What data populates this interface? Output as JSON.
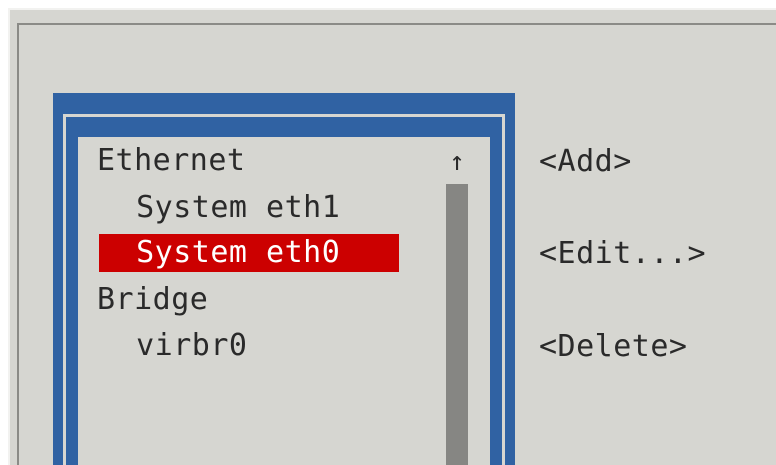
{
  "connection_list": {
    "items": [
      {
        "label": "Ethernet",
        "type": "category"
      },
      {
        "label": "System eth1",
        "type": "connection"
      },
      {
        "label": "System eth0",
        "type": "connection",
        "selected": true
      },
      {
        "label": "Bridge",
        "type": "category"
      },
      {
        "label": "virbr0",
        "type": "connection"
      }
    ],
    "scrollbar": {
      "up_arrow": "↑"
    }
  },
  "actions": {
    "add_label": "<Add>",
    "edit_label": "<Edit...>",
    "delete_label": "<Delete>"
  },
  "colors": {
    "background": "#d6d6d1",
    "frame": "#3062a3",
    "selection": "#cc0000",
    "text": "#2a2a2a",
    "scrollbar": "#868683"
  }
}
